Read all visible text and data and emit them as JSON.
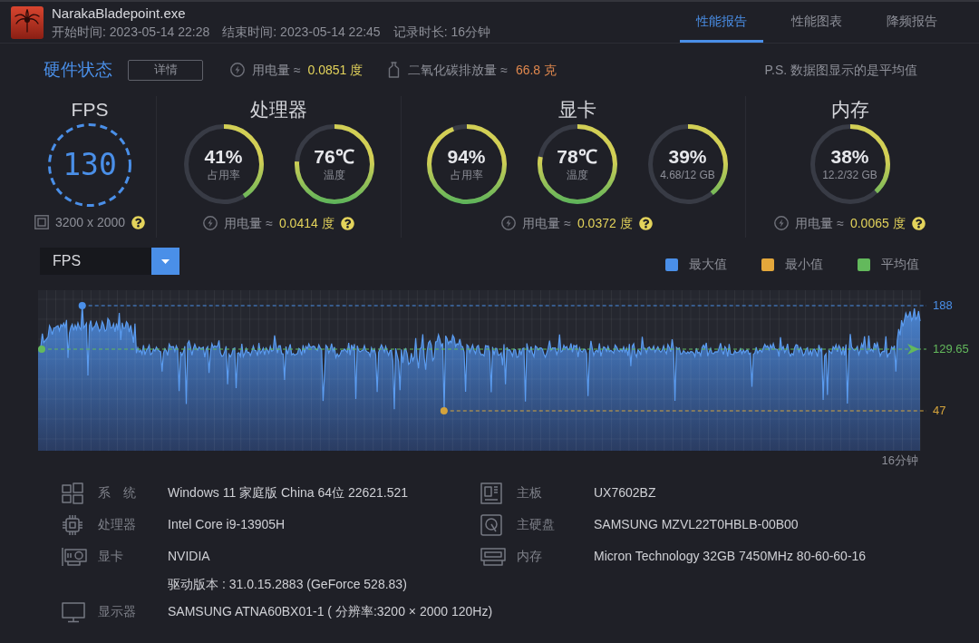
{
  "header": {
    "app_name": "NarakaBladepoint.exe",
    "meta": [
      "开始时间: 2023-05-14 22:28",
      "结束时间: 2023-05-14 22:45",
      "记录时长: 16分钟"
    ]
  },
  "tabs": [
    {
      "label": "性能报告",
      "selected": true
    },
    {
      "label": "性能图表",
      "selected": false
    },
    {
      "label": "降频报告",
      "selected": false
    }
  ],
  "summary": {
    "title": "硬件状态",
    "details_button": "详情",
    "power": {
      "label": "用电量 ≈",
      "value": "0.0851 度"
    },
    "emissions": {
      "label": "二氧化碳排放量 ≈",
      "value": "66.8 克"
    },
    "note": "P.S. 数据图显示的是平均值"
  },
  "sections": [
    {
      "kind": "fps",
      "title": "FPS",
      "value": "130",
      "resolution": "3200 x 2000"
    },
    {
      "kind": "gauges",
      "title": "处理器",
      "gauges": [
        {
          "value": "41%",
          "label": "占用率",
          "level": 0.41
        },
        {
          "value": "76℃",
          "label": "温度",
          "level": 0.76
        }
      ],
      "power": {
        "label": "用电量 ≈",
        "value": "0.0414 度"
      }
    },
    {
      "kind": "gauges",
      "title": "显卡",
      "gauges": [
        {
          "value": "94%",
          "label": "占用率",
          "level": 0.94
        },
        {
          "value": "78℃",
          "label": "温度",
          "level": 0.78
        },
        {
          "value": "39%",
          "label": "4.68/12 GB",
          "level": 0.39
        }
      ],
      "power": {
        "label": "用电量 ≈",
        "value": "0.0372 度"
      }
    },
    {
      "kind": "gauges",
      "title": "内存",
      "gauges": [
        {
          "value": "38%",
          "label": "12.2/32 GB",
          "level": 0.38
        }
      ],
      "power": {
        "label": "用电量 ≈",
        "value": "0.0065 度"
      }
    }
  ],
  "chart_panel": {
    "metric": "FPS",
    "legend": [
      {
        "label": "最大值",
        "color": "#4a8fe8"
      },
      {
        "label": "最小值",
        "color": "#e3a73b"
      },
      {
        "label": "平均值",
        "color": "#63b95c"
      }
    ],
    "markers": [
      {
        "kind": "max",
        "label": "188",
        "color": "#4a8fe8"
      },
      {
        "kind": "avg",
        "label": "129.65",
        "color": "#63b95c"
      },
      {
        "kind": "min",
        "label": "47",
        "color": "#d4a33c"
      }
    ],
    "x_end_label": "16分钟"
  },
  "system_info": {
    "left": [
      {
        "kind": "os",
        "label": "系　统",
        "value": "Windows 11 家庭版 China 64位 22621.521"
      },
      {
        "kind": "cpu",
        "label": "处理器",
        "value": "Intel Core i9-13905H"
      },
      {
        "kind": "gpu",
        "label": "显卡",
        "value": "NVIDIA",
        "detail": "驱动版本 : 31.0.15.2883 (GeForce 528.83)"
      },
      {
        "kind": "display",
        "label": "显示器",
        "value": "SAMSUNG ATNA60BX01-1 ( 分辨率:3200 × 2000 120Hz)"
      }
    ],
    "right": [
      {
        "kind": "board",
        "label": "主板",
        "value": "UX7602BZ"
      },
      {
        "kind": "disk",
        "label": "主硬盘",
        "value": "SAMSUNG MZVL22T0HBLB-00B00"
      },
      {
        "kind": "memory",
        "label": "内存",
        "value": "Micron Technology 32GB 7450MHz 80-60-60-16"
      }
    ]
  }
}
